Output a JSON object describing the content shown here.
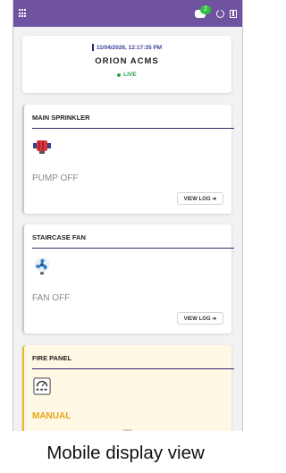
{
  "status_bar": {
    "notification_count": "2"
  },
  "header": {
    "timestamp": "11/04/2026, 12:17:35 PM",
    "site_name": "ORION ACMS",
    "live_label": "LIVE"
  },
  "devices": [
    {
      "title": "MAIN SPRINKLER",
      "icon": "pump-icon",
      "status": "PUMP OFF",
      "button": "VIEW LOG ➔"
    },
    {
      "title": "STAIRCASE FAN",
      "icon": "fan-icon",
      "status": "FAN OFF",
      "button": "VIEW LOG ➔"
    },
    {
      "title": "FIRE PANEL",
      "icon": "fire-panel-icon",
      "status": "MANUAL"
    }
  ],
  "colors": {
    "status_bar": "#6f52a0",
    "accent_navy": "#2e2a6b",
    "live_green": "#23a84a",
    "manual_amber": "#e8a317"
  },
  "caption": "Mobile display view"
}
